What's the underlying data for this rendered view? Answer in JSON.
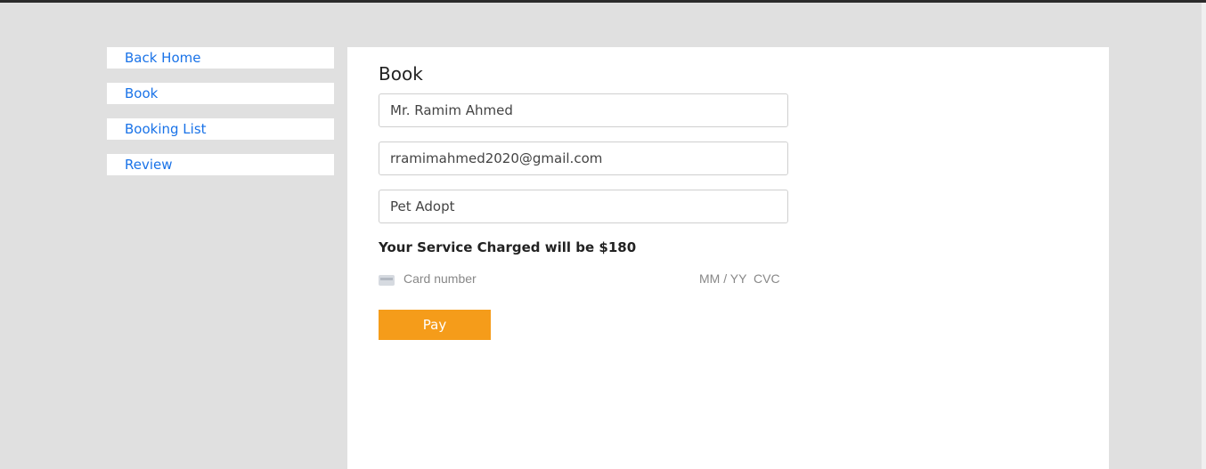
{
  "sidebar": {
    "items": [
      {
        "label": "Back Home"
      },
      {
        "label": "Book"
      },
      {
        "label": "Booking List"
      },
      {
        "label": "Review"
      }
    ]
  },
  "main": {
    "title": "Book",
    "name_value": "Mr. Ramim Ahmed",
    "email_value": "rramimahmed2020@gmail.com",
    "service_value": "Pet Adopt",
    "charge_text": "Your Service Charged will be $180",
    "card": {
      "number_placeholder": "Card number",
      "expiry_placeholder": "MM / YY",
      "cvc_placeholder": "CVC",
      "icon": "credit-card-icon"
    },
    "pay_label": "Pay"
  },
  "colors": {
    "background": "#e0e0e0",
    "link": "#1a73e8",
    "pay_button": "#f59c1a"
  }
}
